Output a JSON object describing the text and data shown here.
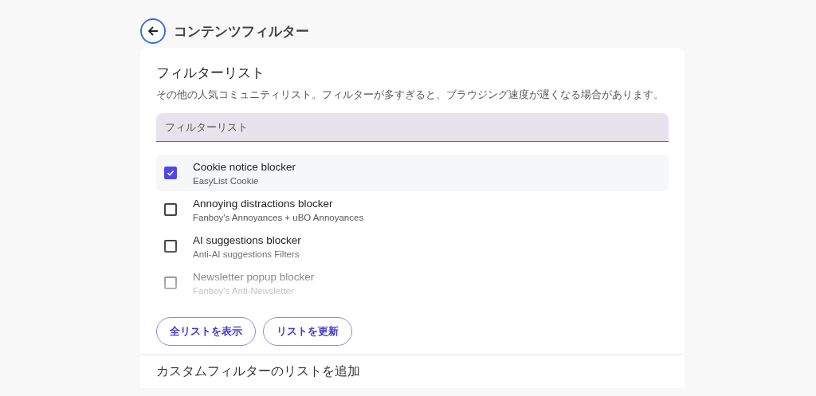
{
  "header": {
    "title": "コンテンツフィルター"
  },
  "filter_lists": {
    "title": "フィルターリスト",
    "description": "その他の人気コミュニティリスト。フィルターが多すぎると、ブラウジング速度が遅くなる場合があります。",
    "search": {
      "placeholder": "フィルターリスト"
    },
    "items": [
      {
        "name": "Cookie notice blocker",
        "source": "EasyList Cookie",
        "checked": true
      },
      {
        "name": "Annoying distractions blocker",
        "source": "Fanboy's Annoyances + uBO Annoyances",
        "checked": false
      },
      {
        "name": "AI suggestions blocker",
        "source": "Anti-AI suggestions Filters",
        "checked": false
      },
      {
        "name": "Newsletter popup blocker",
        "source": "Fanboy's Anti-Newsletter",
        "checked": false
      }
    ],
    "buttons": [
      "全リストを表示",
      "リストを更新"
    ]
  },
  "custom_section": {
    "title": "カスタムフィルターのリストを追加"
  }
}
